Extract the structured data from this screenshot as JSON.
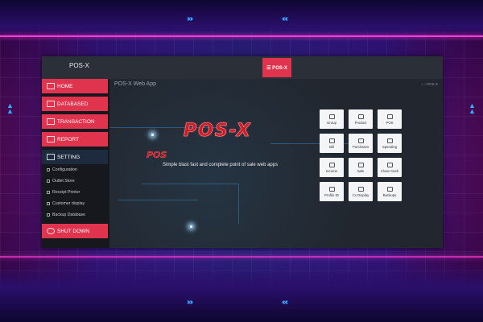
{
  "app": {
    "brand": "POS-X",
    "menu_button": "☰ POS-X",
    "page_title": "POS-X Web App",
    "breadcrumb": "⌂ › POS-X"
  },
  "sidebar": {
    "items": [
      {
        "label": "HOME",
        "icon": "monitor-icon"
      },
      {
        "label": "DATABASED",
        "icon": "database-icon"
      },
      {
        "label": "TRANSACTION",
        "icon": "cart-icon"
      },
      {
        "label": "REPORT",
        "icon": "report-icon"
      },
      {
        "label": "SETTING",
        "icon": "wrench-icon"
      },
      {
        "label": "SHUT DOWN",
        "icon": "power-icon"
      }
    ],
    "settings_sub": [
      {
        "label": "Configuration",
        "icon": "gear-icon"
      },
      {
        "label": "Outlet Store",
        "icon": "store-icon"
      },
      {
        "label": "Receipt Printer",
        "icon": "printer-icon"
      },
      {
        "label": "Customer display",
        "icon": "display-icon"
      },
      {
        "label": "Backup Database",
        "icon": "backup-icon"
      }
    ]
  },
  "hero": {
    "logo_big": "POS-X",
    "logo_small": "POS",
    "tagline": "Simple blast fast and complete point of sale web apps"
  },
  "tiles": [
    {
      "label": "Group",
      "icon": "group-icon"
    },
    {
      "label": "Product",
      "icon": "box-icon"
    },
    {
      "label": "POS",
      "icon": "home-icon"
    },
    {
      "label": "Bill",
      "icon": "bill-icon"
    },
    {
      "label": "Purchases",
      "icon": "purchases-icon"
    },
    {
      "label": "Spending",
      "icon": "spending-icon"
    },
    {
      "label": "Income",
      "icon": "income-icon"
    },
    {
      "label": "Sale",
      "icon": "sale-icon"
    },
    {
      "label": "Close Cash",
      "icon": "close-cash-icon"
    },
    {
      "label": "Profile ID",
      "icon": "wrench-icon"
    },
    {
      "label": "Cx Display",
      "icon": "image-icon"
    },
    {
      "label": "Backups",
      "icon": "backup-icon"
    }
  ],
  "colors": {
    "accent": "#e0334d",
    "sidebar_bg": "#16181d",
    "content_bg": "#22262e",
    "active_nav": "#1e2a3d",
    "logo_red": "#c81e28"
  }
}
